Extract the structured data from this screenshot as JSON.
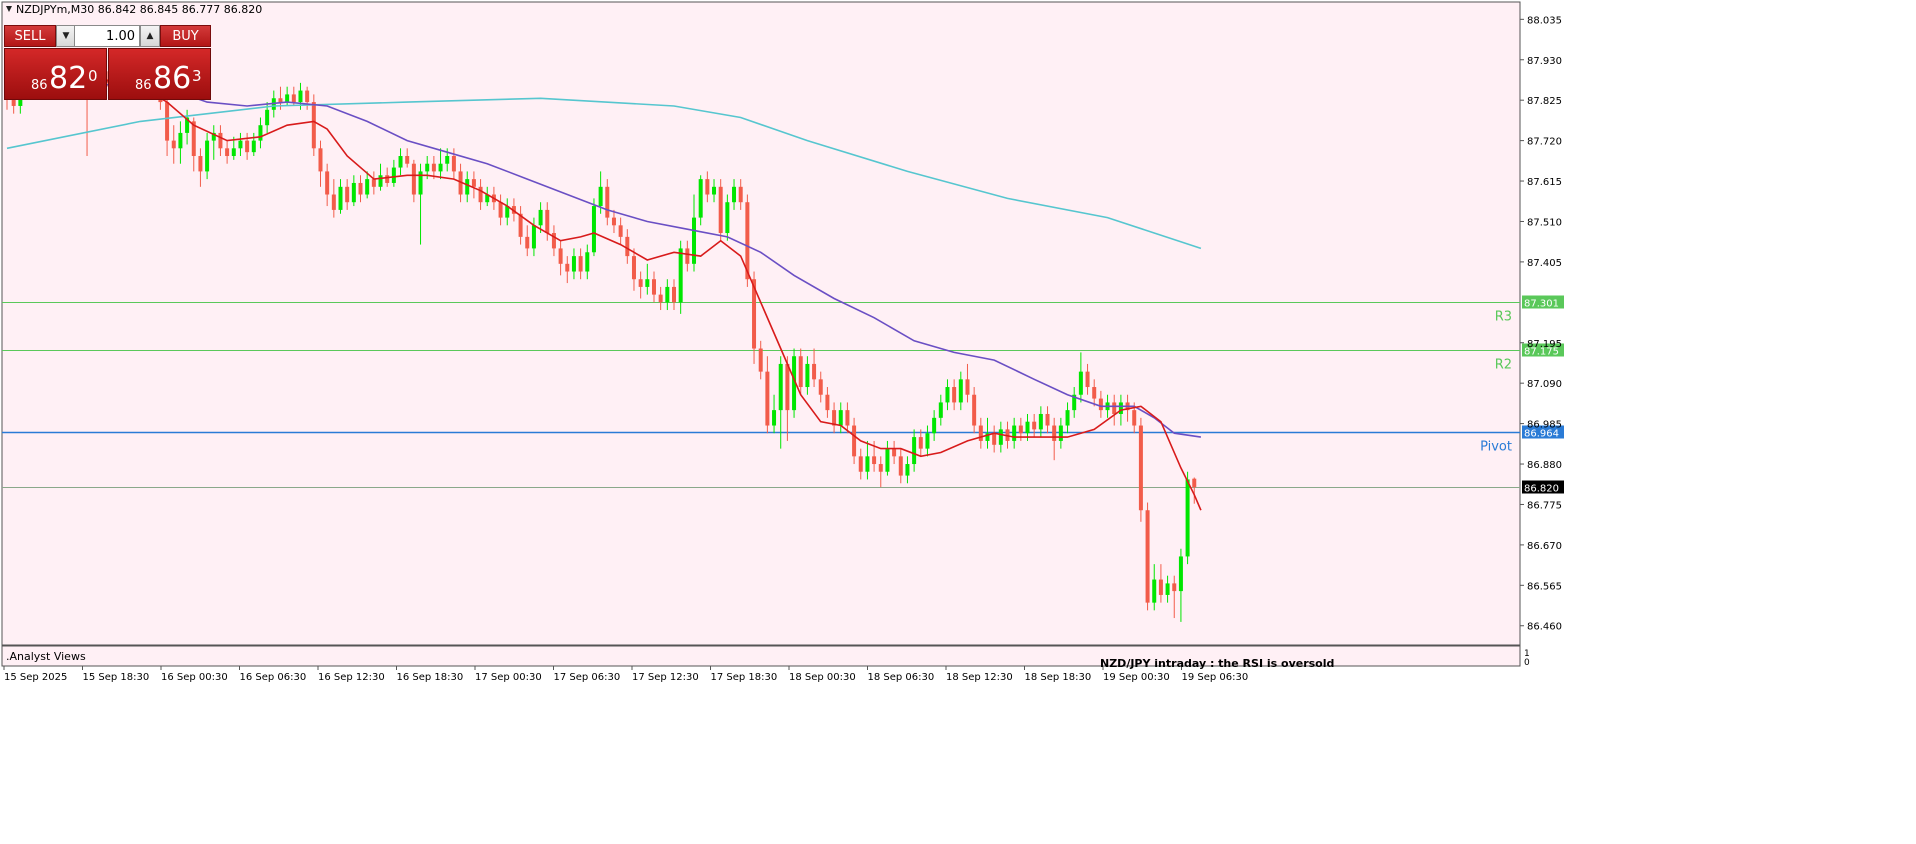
{
  "header": {
    "title": "NZDJPYm,M30  86.842 86.845 86.777 86.820"
  },
  "trade_panel": {
    "sell_label": "SELL",
    "buy_label": "BUY",
    "lot_value": "1.00",
    "sell_price": {
      "prefix": "86",
      "big": "82",
      "sup": "0"
    },
    "buy_price": {
      "prefix": "86",
      "big": "86",
      "sup": "3"
    }
  },
  "colors": {
    "background": "#fff0f5",
    "bull_candle": "#00e600",
    "bear_candle": "#f25c4a",
    "ma_fast": "#d81b1b",
    "ma_mid": "#6a4fc4",
    "ma_slow": "#56c6cf",
    "resistance_line": "#5ac85a",
    "pivot_line": "#2a7bd6",
    "current_price_line": "#8aa88a"
  },
  "subwindow_label": ".Analyst Views",
  "subwindow_scale": [
    "1",
    "0"
  ],
  "commentary": "NZD/JPY intraday :  the RSI is oversold",
  "chart_data": {
    "type": "candlestick",
    "symbol": "NZDJPYm",
    "timeframe": "M30",
    "ylim": [
      86.41,
      88.08
    ],
    "y_ticks": [
      "88.035",
      "87.930",
      "87.825",
      "87.720",
      "87.615",
      "87.510",
      "87.405",
      "87.195",
      "87.090",
      "86.985",
      "86.880",
      "86.775",
      "86.670",
      "86.565",
      "86.460"
    ],
    "x_ticks": [
      "15 Sep 2025",
      "15 Sep 18:30",
      "16 Sep 00:30",
      "16 Sep 06:30",
      "16 Sep 12:30",
      "16 Sep 18:30",
      "17 Sep 00:30",
      "17 Sep 06:30",
      "17 Sep 12:30",
      "17 Sep 18:30",
      "18 Sep 00:30",
      "18 Sep 06:30",
      "18 Sep 12:30",
      "18 Sep 18:30",
      "19 Sep 00:30",
      "19 Sep 06:30"
    ],
    "levels": [
      {
        "name": "R3",
        "value": 87.301,
        "label": "87.301"
      },
      {
        "name": "R2",
        "value": 87.175,
        "label": "87.175"
      },
      {
        "name": "Pivot",
        "value": 86.964,
        "label": "86.964"
      }
    ],
    "current_price": {
      "value": 86.82,
      "label": "86.820"
    },
    "candles": [
      [
        87.865,
        87.84,
        87.88,
        87.8
      ],
      [
        87.84,
        87.81,
        87.86,
        87.79
      ],
      [
        87.81,
        87.85,
        87.87,
        87.79
      ],
      [
        87.85,
        87.88,
        87.9,
        87.83
      ],
      [
        87.88,
        87.86,
        87.9,
        87.84
      ],
      [
        87.86,
        87.87,
        87.89,
        87.85
      ],
      [
        87.87,
        87.86,
        87.89,
        87.85
      ],
      [
        87.86,
        87.88,
        87.9,
        87.85
      ],
      [
        87.88,
        87.87,
        87.9,
        87.86
      ],
      [
        87.87,
        87.88,
        87.9,
        87.86
      ],
      [
        87.88,
        87.87,
        87.9,
        87.86
      ],
      [
        87.87,
        87.89,
        87.92,
        87.86
      ],
      [
        87.89,
        87.88,
        87.92,
        87.68
      ],
      [
        87.88,
        87.87,
        87.9,
        87.86
      ],
      [
        87.87,
        87.88,
        87.9,
        87.86
      ],
      [
        87.88,
        87.87,
        87.9,
        87.86
      ],
      [
        87.87,
        87.88,
        87.9,
        87.86
      ],
      [
        87.88,
        87.87,
        87.9,
        87.86
      ],
      [
        87.87,
        87.88,
        87.9,
        87.86
      ],
      [
        87.88,
        87.87,
        87.9,
        87.86
      ],
      [
        87.87,
        87.88,
        87.9,
        87.86
      ],
      [
        87.88,
        87.87,
        87.9,
        87.86
      ],
      [
        87.87,
        87.85,
        87.88,
        87.84
      ],
      [
        87.85,
        87.82,
        87.86,
        87.8
      ],
      [
        87.82,
        87.72,
        87.84,
        87.68
      ],
      [
        87.72,
        87.7,
        87.76,
        87.66
      ],
      [
        87.7,
        87.74,
        87.77,
        87.66
      ],
      [
        87.74,
        87.78,
        87.8,
        87.71
      ],
      [
        87.77,
        87.68,
        87.78,
        87.64
      ],
      [
        87.68,
        87.64,
        87.7,
        87.6
      ],
      [
        87.64,
        87.72,
        87.74,
        87.62
      ],
      [
        87.72,
        87.74,
        87.76,
        87.67
      ],
      [
        87.74,
        87.7,
        87.76,
        87.68
      ],
      [
        87.7,
        87.68,
        87.72,
        87.66
      ],
      [
        87.68,
        87.7,
        87.73,
        87.67
      ],
      [
        87.7,
        87.72,
        87.74,
        87.68
      ],
      [
        87.72,
        87.69,
        87.74,
        87.67
      ],
      [
        87.69,
        87.72,
        87.74,
        87.68
      ],
      [
        87.72,
        87.76,
        87.78,
        87.7
      ],
      [
        87.76,
        87.8,
        87.82,
        87.74
      ],
      [
        87.8,
        87.83,
        87.85,
        87.78
      ],
      [
        87.83,
        87.82,
        87.86,
        87.8
      ],
      [
        87.82,
        87.84,
        87.86,
        87.81
      ],
      [
        87.84,
        87.82,
        87.86,
        87.81
      ],
      [
        87.82,
        87.85,
        87.87,
        87.8
      ],
      [
        87.85,
        87.82,
        87.86,
        87.8
      ],
      [
        87.82,
        87.7,
        87.84,
        87.68
      ],
      [
        87.7,
        87.64,
        87.72,
        87.6
      ],
      [
        87.64,
        87.58,
        87.66,
        87.55
      ],
      [
        87.58,
        87.54,
        87.62,
        87.52
      ],
      [
        87.54,
        87.6,
        87.62,
        87.53
      ],
      [
        87.6,
        87.56,
        87.62,
        87.54
      ],
      [
        87.56,
        87.61,
        87.63,
        87.55
      ],
      [
        87.61,
        87.58,
        87.63,
        87.56
      ],
      [
        87.58,
        87.62,
        87.64,
        87.57
      ],
      [
        87.62,
        87.6,
        87.64,
        87.58
      ],
      [
        87.6,
        87.63,
        87.66,
        87.59
      ],
      [
        87.63,
        87.61,
        87.65,
        87.6
      ],
      [
        87.61,
        87.65,
        87.67,
        87.6
      ],
      [
        87.65,
        87.68,
        87.7,
        87.63
      ],
      [
        87.68,
        87.66,
        87.7,
        87.65
      ],
      [
        87.66,
        87.58,
        87.67,
        87.56
      ],
      [
        87.58,
        87.64,
        87.66,
        87.45
      ],
      [
        87.64,
        87.66,
        87.68,
        87.62
      ],
      [
        87.66,
        87.64,
        87.68,
        87.62
      ],
      [
        87.64,
        87.66,
        87.7,
        87.62
      ],
      [
        87.66,
        87.68,
        87.7,
        87.64
      ],
      [
        87.68,
        87.64,
        87.7,
        87.62
      ],
      [
        87.64,
        87.58,
        87.66,
        87.56
      ],
      [
        87.58,
        87.62,
        87.64,
        87.56
      ],
      [
        87.62,
        87.6,
        87.64,
        87.57
      ],
      [
        87.6,
        87.56,
        87.62,
        87.54
      ],
      [
        87.56,
        87.58,
        87.6,
        87.55
      ],
      [
        87.58,
        87.56,
        87.6,
        87.54
      ],
      [
        87.56,
        87.52,
        87.58,
        87.5
      ],
      [
        87.52,
        87.55,
        87.57,
        87.5
      ],
      [
        87.55,
        87.53,
        87.57,
        87.51
      ],
      [
        87.53,
        87.47,
        87.55,
        87.45
      ],
      [
        87.47,
        87.44,
        87.5,
        87.42
      ],
      [
        87.44,
        87.5,
        87.52,
        87.42
      ],
      [
        87.5,
        87.54,
        87.56,
        87.48
      ],
      [
        87.54,
        87.48,
        87.56,
        87.46
      ],
      [
        87.48,
        87.44,
        87.5,
        87.42
      ],
      [
        87.44,
        87.4,
        87.46,
        87.37
      ],
      [
        87.4,
        87.38,
        87.42,
        87.35
      ],
      [
        87.38,
        87.42,
        87.44,
        87.36
      ],
      [
        87.42,
        87.38,
        87.44,
        87.36
      ],
      [
        87.38,
        87.43,
        87.45,
        87.36
      ],
      [
        87.43,
        87.55,
        87.57,
        87.42
      ],
      [
        87.55,
        87.6,
        87.64,
        87.53
      ],
      [
        87.6,
        87.52,
        87.62,
        87.5
      ],
      [
        87.52,
        87.5,
        87.54,
        87.48
      ],
      [
        87.5,
        87.47,
        87.52,
        87.45
      ],
      [
        87.47,
        87.42,
        87.49,
        87.4
      ],
      [
        87.42,
        87.36,
        87.44,
        87.33
      ],
      [
        87.36,
        87.34,
        87.38,
        87.31
      ],
      [
        87.34,
        87.36,
        87.4,
        87.32
      ],
      [
        87.36,
        87.32,
        87.38,
        87.3
      ],
      [
        87.32,
        87.3,
        87.34,
        87.28
      ],
      [
        87.3,
        87.34,
        87.36,
        87.28
      ],
      [
        87.34,
        87.3,
        87.36,
        87.28
      ],
      [
        87.3,
        87.44,
        87.46,
        87.27
      ],
      [
        87.44,
        87.4,
        87.46,
        87.38
      ],
      [
        87.4,
        87.52,
        87.58,
        87.38
      ],
      [
        87.52,
        87.62,
        87.63,
        87.5
      ],
      [
        87.62,
        87.58,
        87.64,
        87.56
      ],
      [
        87.58,
        87.6,
        87.62,
        87.56
      ],
      [
        87.6,
        87.48,
        87.62,
        87.46
      ],
      [
        87.48,
        87.56,
        87.58,
        87.46
      ],
      [
        87.56,
        87.6,
        87.62,
        87.54
      ],
      [
        87.6,
        87.56,
        87.62,
        87.54
      ],
      [
        87.56,
        87.36,
        87.58,
        87.34
      ],
      [
        87.36,
        87.18,
        87.38,
        87.14
      ],
      [
        87.18,
        87.12,
        87.2,
        87.1
      ],
      [
        87.12,
        86.98,
        87.16,
        86.96
      ],
      [
        86.98,
        87.02,
        87.06,
        86.96
      ],
      [
        87.02,
        87.14,
        87.16,
        86.92
      ],
      [
        87.14,
        87.02,
        87.16,
        86.94
      ],
      [
        87.02,
        87.16,
        87.18,
        87.0
      ],
      [
        87.16,
        87.08,
        87.18,
        87.06
      ],
      [
        87.08,
        87.14,
        87.16,
        87.06
      ],
      [
        87.14,
        87.1,
        87.18,
        87.08
      ],
      [
        87.1,
        87.06,
        87.12,
        87.04
      ],
      [
        87.06,
        87.02,
        87.08,
        87.0
      ],
      [
        87.02,
        86.98,
        87.04,
        86.96
      ],
      [
        86.98,
        87.02,
        87.04,
        86.96
      ],
      [
        87.02,
        86.98,
        87.04,
        86.96
      ],
      [
        86.98,
        86.9,
        87.0,
        86.88
      ],
      [
        86.9,
        86.86,
        86.92,
        86.84
      ],
      [
        86.86,
        86.9,
        86.94,
        86.84
      ],
      [
        86.9,
        86.88,
        86.94,
        86.86
      ],
      [
        86.88,
        86.86,
        86.9,
        86.82
      ],
      [
        86.86,
        86.92,
        86.94,
        86.85
      ],
      [
        86.92,
        86.9,
        86.94,
        86.88
      ],
      [
        86.9,
        86.85,
        86.92,
        86.83
      ],
      [
        86.85,
        86.88,
        86.9,
        86.83
      ],
      [
        86.88,
        86.95,
        86.97,
        86.86
      ],
      [
        86.95,
        86.92,
        86.97,
        86.9
      ],
      [
        86.92,
        86.96,
        86.98,
        86.9
      ],
      [
        86.96,
        87.0,
        87.02,
        86.94
      ],
      [
        87.0,
        87.04,
        87.06,
        86.98
      ],
      [
        87.04,
        87.08,
        87.1,
        87.02
      ],
      [
        87.08,
        87.04,
        87.1,
        87.02
      ],
      [
        87.04,
        87.1,
        87.12,
        87.02
      ],
      [
        87.1,
        87.06,
        87.14,
        87.04
      ],
      [
        87.06,
        86.98,
        87.08,
        86.96
      ],
      [
        86.98,
        86.94,
        87.0,
        86.92
      ],
      [
        86.94,
        86.96,
        87.0,
        86.92
      ],
      [
        86.96,
        86.93,
        86.98,
        86.91
      ],
      [
        86.93,
        86.97,
        86.99,
        86.91
      ],
      [
        86.97,
        86.94,
        86.99,
        86.92
      ],
      [
        86.94,
        86.98,
        87.0,
        86.92
      ],
      [
        86.98,
        86.96,
        87.0,
        86.94
      ],
      [
        86.96,
        86.99,
        87.01,
        86.94
      ],
      [
        86.99,
        86.97,
        87.01,
        86.95
      ],
      [
        86.97,
        87.01,
        87.03,
        86.95
      ],
      [
        87.01,
        86.98,
        87.03,
        86.96
      ],
      [
        86.98,
        86.94,
        87.0,
        86.89
      ],
      [
        86.94,
        86.98,
        87.0,
        86.92
      ],
      [
        86.98,
        87.02,
        87.04,
        86.96
      ],
      [
        87.02,
        87.06,
        87.08,
        87.0
      ],
      [
        87.06,
        87.12,
        87.17,
        87.04
      ],
      [
        87.12,
        87.08,
        87.14,
        87.06
      ],
      [
        87.08,
        87.05,
        87.1,
        87.03
      ],
      [
        87.05,
        87.02,
        87.07,
        87.0
      ],
      [
        87.02,
        87.04,
        87.06,
        87.0
      ],
      [
        87.04,
        87.01,
        87.06,
        86.98
      ],
      [
        87.01,
        87.04,
        87.06,
        86.98
      ],
      [
        87.04,
        87.02,
        87.06,
        86.99
      ],
      [
        87.02,
        86.98,
        87.04,
        86.96
      ],
      [
        86.98,
        86.76,
        87.0,
        86.73
      ],
      [
        86.76,
        86.52,
        86.78,
        86.5
      ],
      [
        86.52,
        86.58,
        86.62,
        86.5
      ],
      [
        86.58,
        86.54,
        86.62,
        86.52
      ],
      [
        86.54,
        86.57,
        86.59,
        86.52
      ],
      [
        86.57,
        86.55,
        86.59,
        86.48
      ],
      [
        86.55,
        86.64,
        86.66,
        86.47
      ],
      [
        86.64,
        86.84,
        86.86,
        86.62
      ],
      [
        86.842,
        86.82,
        86.845,
        86.777
      ]
    ],
    "ma_fast": [
      [
        0,
        87.84
      ],
      [
        6,
        87.86
      ],
      [
        12,
        87.88
      ],
      [
        19,
        87.87
      ],
      [
        24,
        87.82
      ],
      [
        28,
        87.76
      ],
      [
        33,
        87.72
      ],
      [
        38,
        87.73
      ],
      [
        42,
        87.76
      ],
      [
        46,
        87.77
      ],
      [
        48,
        87.75
      ],
      [
        51,
        87.68
      ],
      [
        55,
        87.62
      ],
      [
        60,
        87.63
      ],
      [
        63,
        87.63
      ],
      [
        67,
        87.62
      ],
      [
        71,
        87.59
      ],
      [
        75,
        87.55
      ],
      [
        79,
        87.5
      ],
      [
        83,
        87.46
      ],
      [
        86,
        87.47
      ],
      [
        88,
        87.48
      ],
      [
        92,
        87.45
      ],
      [
        96,
        87.41
      ],
      [
        100,
        87.43
      ],
      [
        104,
        87.42
      ],
      [
        107,
        87.46
      ],
      [
        110,
        87.42
      ],
      [
        113,
        87.3
      ],
      [
        116,
        87.18
      ],
      [
        119,
        87.06
      ],
      [
        122,
        86.99
      ],
      [
        125,
        86.98
      ],
      [
        128,
        86.94
      ],
      [
        131,
        86.92
      ],
      [
        134,
        86.92
      ],
      [
        137,
        86.9
      ],
      [
        140,
        86.91
      ],
      [
        144,
        86.94
      ],
      [
        148,
        86.96
      ],
      [
        151,
        86.95
      ],
      [
        155,
        86.95
      ],
      [
        159,
        86.95
      ],
      [
        163,
        86.97
      ],
      [
        167,
        87.02
      ],
      [
        170,
        87.03
      ],
      [
        173,
        86.99
      ],
      [
        176,
        86.87
      ],
      [
        178,
        86.8
      ],
      [
        179,
        86.76
      ]
    ],
    "ma_mid": [
      [
        0,
        87.84
      ],
      [
        10,
        87.86
      ],
      [
        20,
        87.87
      ],
      [
        25,
        87.85
      ],
      [
        30,
        87.82
      ],
      [
        36,
        87.81
      ],
      [
        42,
        87.82
      ],
      [
        48,
        87.81
      ],
      [
        54,
        87.77
      ],
      [
        60,
        87.72
      ],
      [
        66,
        87.69
      ],
      [
        72,
        87.66
      ],
      [
        78,
        87.62
      ],
      [
        84,
        87.58
      ],
      [
        90,
        87.54
      ],
      [
        96,
        87.51
      ],
      [
        102,
        87.49
      ],
      [
        108,
        87.47
      ],
      [
        113,
        87.43
      ],
      [
        118,
        87.37
      ],
      [
        124,
        87.31
      ],
      [
        130,
        87.26
      ],
      [
        136,
        87.2
      ],
      [
        142,
        87.17
      ],
      [
        148,
        87.15
      ],
      [
        154,
        87.1
      ],
      [
        159,
        87.06
      ],
      [
        164,
        87.03
      ],
      [
        169,
        87.03
      ],
      [
        172,
        87.0
      ],
      [
        175,
        86.96
      ],
      [
        179,
        86.95
      ]
    ],
    "ma_slow": [
      [
        0,
        87.7
      ],
      [
        20,
        87.77
      ],
      [
        40,
        87.81
      ],
      [
        60,
        87.82
      ],
      [
        80,
        87.83
      ],
      [
        100,
        87.81
      ],
      [
        110,
        87.78
      ],
      [
        120,
        87.72
      ],
      [
        135,
        87.64
      ],
      [
        150,
        87.57
      ],
      [
        165,
        87.52
      ],
      [
        172,
        87.48
      ],
      [
        179,
        87.44
      ]
    ],
    "annotations": [
      "R3",
      "R2",
      "Pivot"
    ]
  }
}
